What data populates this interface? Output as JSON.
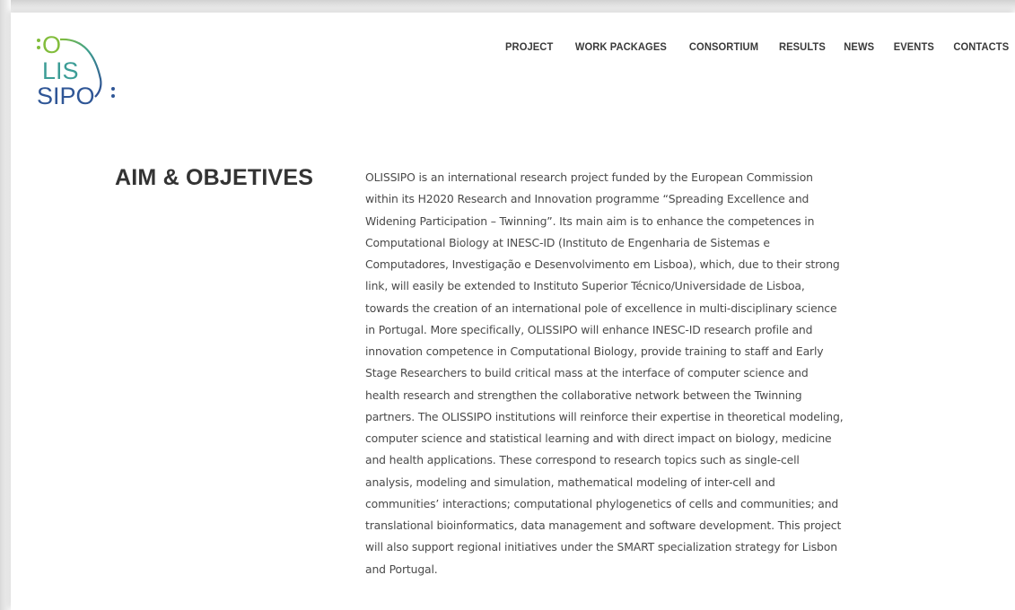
{
  "brand": {
    "logo_text": "OLISSIPO",
    "logo_line1": "O",
    "logo_line2": "LIS",
    "logo_line3": "SIPO",
    "colors": {
      "green": "#7db63b",
      "teal": "#2f8fa3",
      "blue": "#2e5f9e",
      "navy": "#2d4f8f"
    }
  },
  "nav": {
    "items": [
      {
        "label": "PROJECT"
      },
      {
        "label": "WORK PACKAGES"
      },
      {
        "label": "CONSORTIUM"
      },
      {
        "label": "RESULTS"
      },
      {
        "label": "NEWS"
      },
      {
        "label": "EVENTS"
      },
      {
        "label": "CONTACTS"
      }
    ]
  },
  "section": {
    "title": "AIM & OBJETIVES",
    "body": "OLISSIPO is an international research project funded by the European Commission within its H2020 Research and Innovation programme “Spreading Excellence and Widening Participation – Twinning”. Its main aim is to enhance the competences in Computational Biology at INESC-ID (Instituto de Engenharia de Sistemas e Computadores, Investigação e Desenvolvimento em Lisboa), which, due to their strong link, will easily be extended to Instituto Superior Técnico/Universidade de Lisboa, towards the creation of an international pole of excellence in multi-disciplinary science in Portugal. More specifically, OLISSIPO will enhance INESC-ID research profile and innovation competence in Computational Biology, provide training to staff and Early Stage Researchers to build critical mass at the interface of computer science and health research and strengthen the collaborative network between the Twinning partners. The OLISSIPO institutions will reinforce their expertise in theoretical modeling, computer science and statistical learning and with direct impact on biology, medicine and health applications. These correspond to research topics such as single-cell analysis, modeling and simulation, mathematical modeling of inter-cell and communities’ interactions; computational phylogenetics of cells and communities; and translational bioinformatics, data management and software development. This project will also support regional initiatives under the SMART specialization strategy for Lisbon and Portugal."
  }
}
